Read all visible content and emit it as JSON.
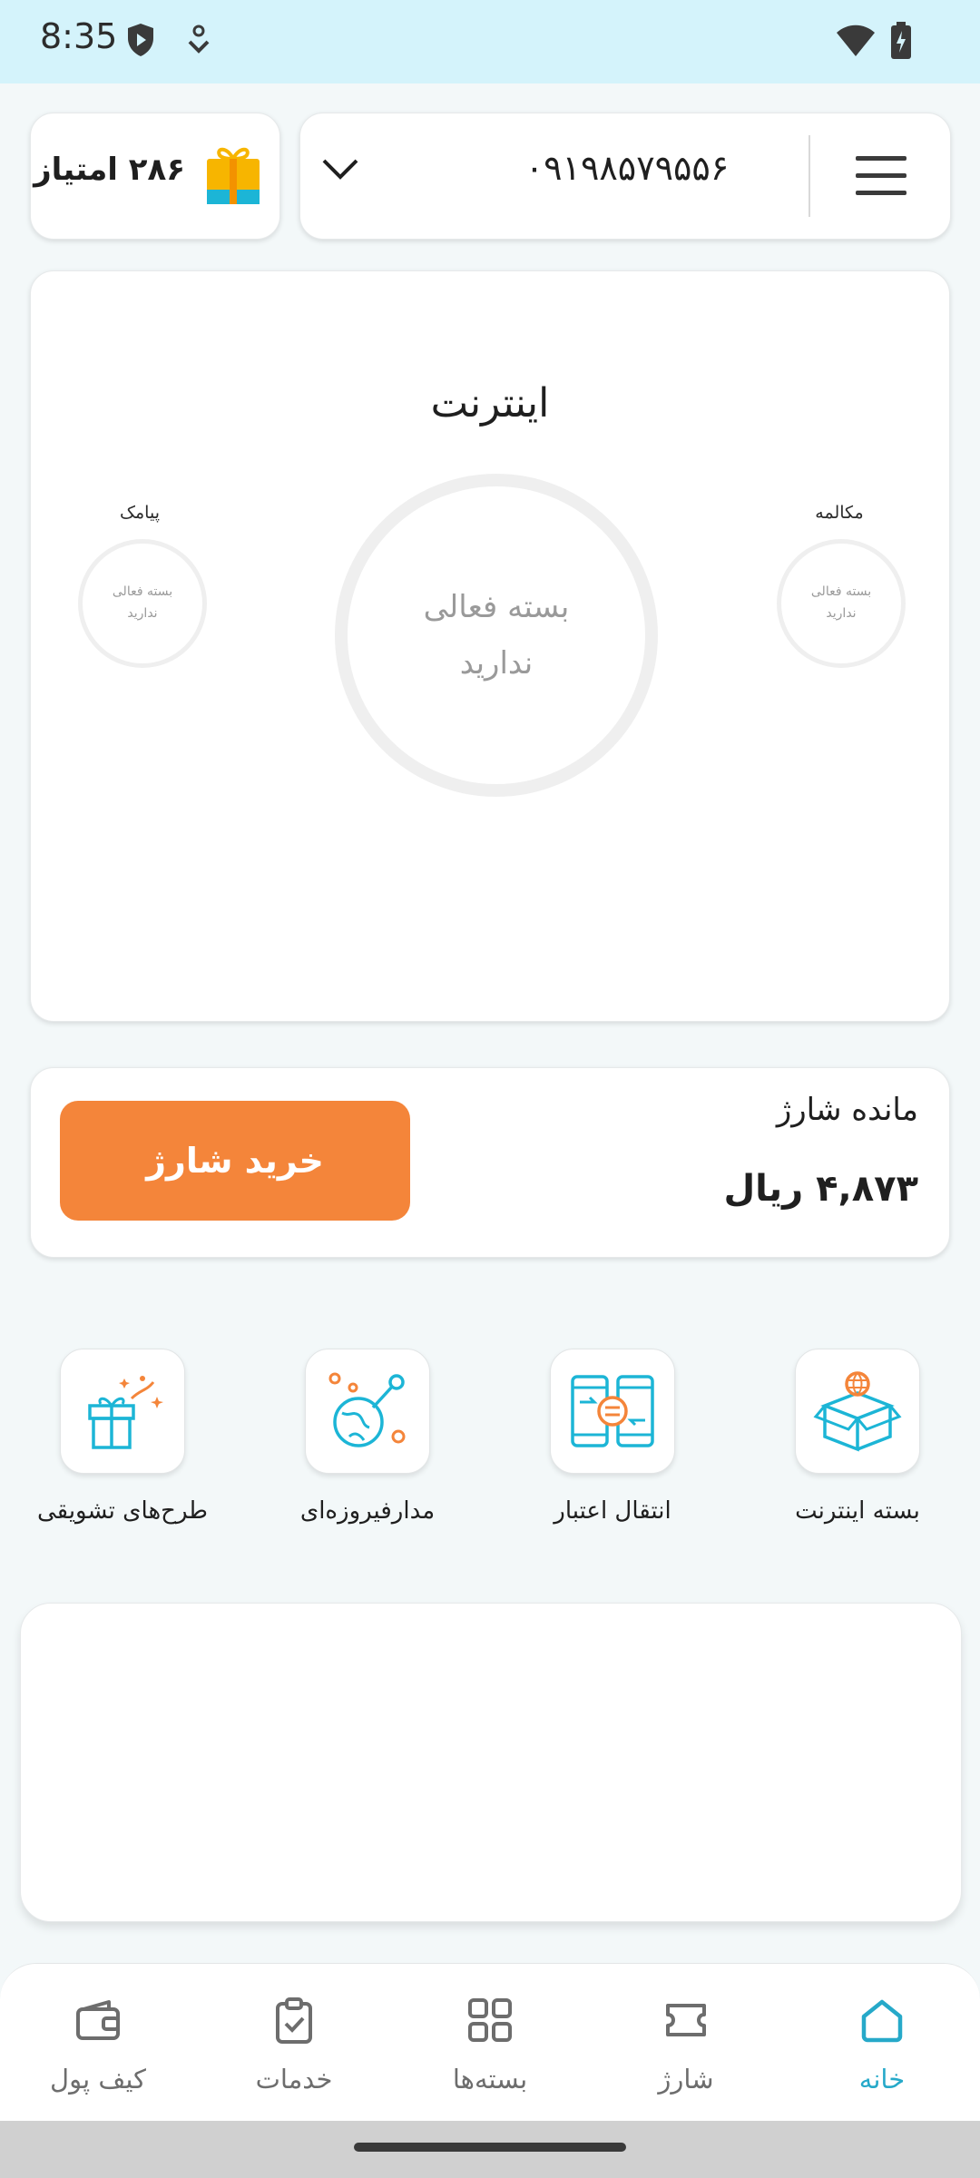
{
  "status_bar": {
    "time": "8:35",
    "icons": [
      "shield-icon",
      "download-icon",
      "wifi-icon",
      "battery-icon"
    ]
  },
  "header": {
    "points_label": "۲۸۶ امتیاز",
    "gift_icon": "gift-icon",
    "phone_number": "۰۹۱۹۸۵۷۹۵۵۶",
    "dropdown_icon": "chevron-down-icon",
    "menu_icon": "menu-icon"
  },
  "usage": {
    "title": "اینترنت",
    "internet_status_line1": "بسته فعالی",
    "internet_status_line2": "ندارید",
    "call": {
      "label": "مکالمه",
      "status_line1": "بسته فعالی",
      "status_line2": "ندارید"
    },
    "sms": {
      "label": "پیامک",
      "status_line1": "بسته فعالی",
      "status_line2": "ندارید"
    }
  },
  "balance": {
    "title": "مانده شارژ",
    "value": "۴,۸۷۳ ریال",
    "buy_button": "خرید شارژ"
  },
  "quick_actions": [
    {
      "label": "بسته اینترنت",
      "icon": "internet-package-box-icon"
    },
    {
      "label": "انتقال اعتبار",
      "icon": "credit-transfer-icon"
    },
    {
      "label": "مدارفیروزه‌ای",
      "icon": "turquoise-orbit-icon"
    },
    {
      "label": "طرح‌های تشویقی",
      "icon": "gift-box-icon"
    }
  ],
  "bottom_nav": [
    {
      "label": "خانه",
      "icon": "home-icon",
      "active": true
    },
    {
      "label": "شارژ",
      "icon": "ticket-icon",
      "active": false
    },
    {
      "label": "بسته‌ها",
      "icon": "grid-icon",
      "active": false
    },
    {
      "label": "خدمات",
      "icon": "clipboard-check-icon",
      "active": false
    },
    {
      "label": "کیف پول",
      "icon": "wallet-icon",
      "active": false
    }
  ],
  "colors": {
    "status_bar_bg": "#D4F3FB",
    "accent_orange": "#F4853A",
    "accent_teal": "#26A9C9",
    "page_bg": "#F3F8F9"
  }
}
